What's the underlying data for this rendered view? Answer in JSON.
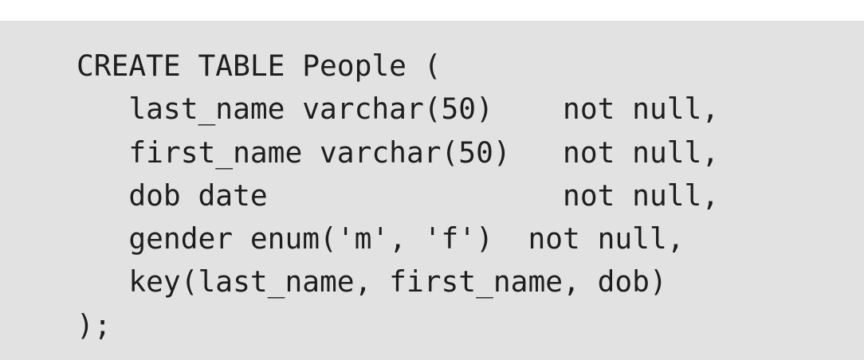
{
  "code_block": {
    "language": "SQL",
    "lines": [
      "CREATE TABLE People (",
      "   last_name varchar(50)    not null,",
      "   first_name varchar(50)   not null,",
      "   dob date                 not null,",
      "   gender enum('m', 'f')  not null,",
      "   key(last_name, first_name, dob)",
      ");"
    ]
  },
  "colors": {
    "background": "#e2e2e2",
    "text": "#1e1e1e",
    "page": "#ffffff"
  }
}
